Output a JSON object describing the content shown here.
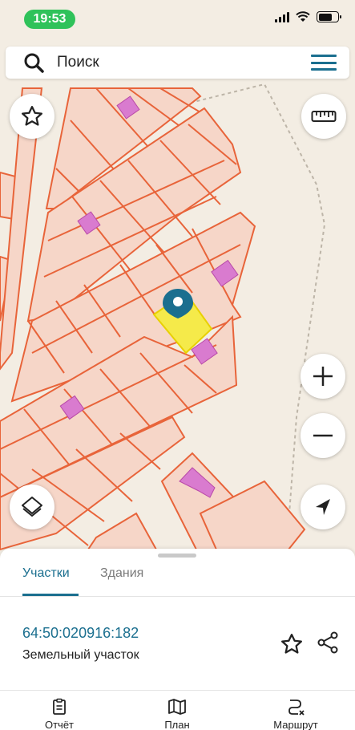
{
  "status_bar": {
    "time": "19:53"
  },
  "search": {
    "placeholder": "Поиск"
  },
  "sheet": {
    "tabs": [
      {
        "label": "Участки",
        "active": true
      },
      {
        "label": "Здания",
        "active": false
      }
    ],
    "parcel": {
      "number": "64:50:020916:182",
      "type": "Земельный участок"
    }
  },
  "bottom_nav": [
    {
      "label": "Отчёт",
      "icon": "report-icon"
    },
    {
      "label": "План",
      "icon": "map-icon"
    },
    {
      "label": "Маршрут",
      "icon": "route-icon"
    }
  ],
  "colors": {
    "accent": "#1b6f8f",
    "parcel_fill": "#f6d6c8",
    "parcel_stroke": "#e8643a",
    "building": "#d97bcf",
    "selected": "#f5ea4a",
    "status_green": "#2fc25a"
  },
  "icons": {
    "search": "search-icon",
    "menu": "hamburger-menu-icon",
    "favorite": "star-icon",
    "ruler": "ruler-icon",
    "zoom_in": "plus-icon",
    "zoom_out": "minus-icon",
    "layers": "layers-icon",
    "locate": "navigation-arrow-icon",
    "share": "share-icon",
    "pin": "map-pin-icon"
  }
}
